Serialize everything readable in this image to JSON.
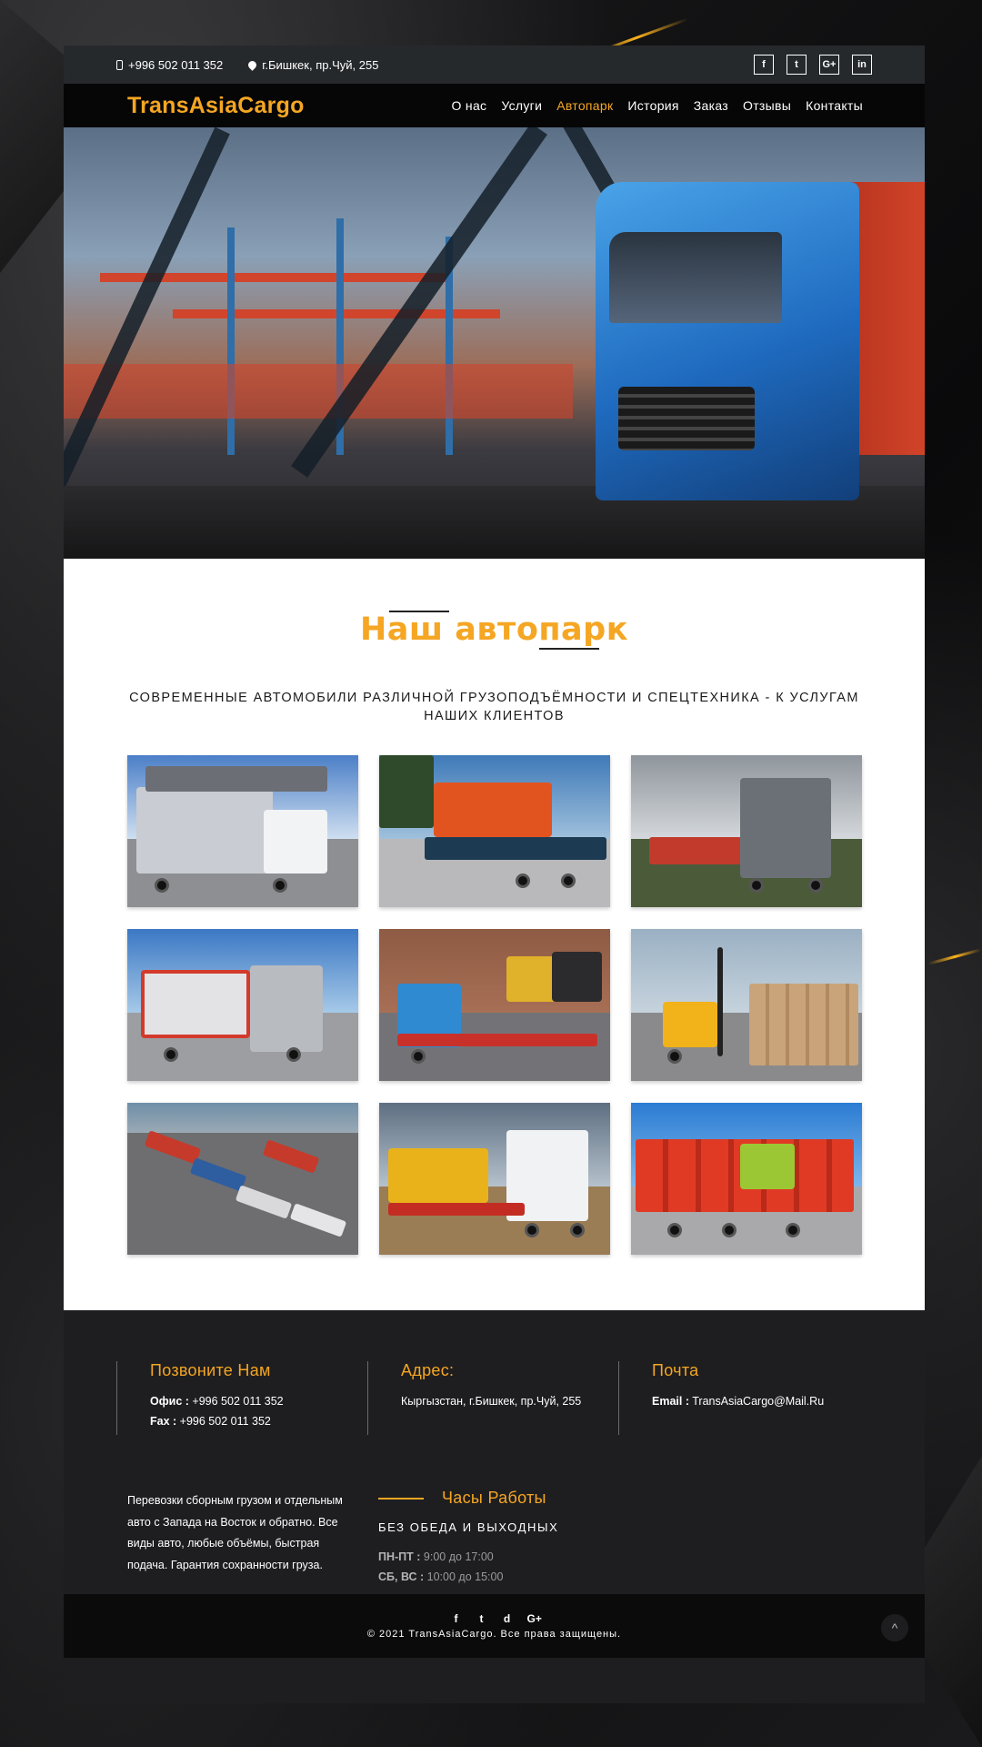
{
  "topbar": {
    "phone": "+996 502 011 352",
    "address": "г.Бишкек, пр.Чуй, 255",
    "socials": [
      "f",
      "t",
      "G+",
      "in"
    ]
  },
  "nav": {
    "logo": "TransAsiaCargo",
    "items": [
      "О нас",
      "Услуги",
      "Автопарк",
      "История",
      "Заказ",
      "Отзывы",
      "Контакты"
    ],
    "active": "Автопарк"
  },
  "fleet": {
    "title": "Наш автопарк",
    "subtitle": "СОВРЕМЕННЫЕ АВТОМОБИЛИ РАЗЛИЧНОЙ ГРУЗОПОДЪЁМНОСТИ И СПЕЦТЕХНИКА - К УСЛУГАМ НАШИХ КЛИЕНТОВ"
  },
  "contacts": {
    "call": {
      "title": "Позвоните Нам",
      "office_label": "Офис :",
      "office": "+996 502 011 352",
      "fax_label": "Fax :",
      "fax": "+996 502 011 352"
    },
    "address": {
      "title": "Адрес:",
      "text": "Кыргызстан, г.Бишкек, пр.Чуй, 255"
    },
    "mail": {
      "title": "Почта",
      "label": "Email :",
      "email": "TransAsiaCargo@Mail.Ru"
    }
  },
  "about": "Перевозки сборным грузом и отдельным авто с Запада на Восток и обратно. Все виды авто, любые объёмы, быстрая подача. Гарантия сохранности груза.",
  "hours": {
    "title": "Часы Работы",
    "subtitle": "БЕЗ ОБЕДА И ВЫХОДНЫХ",
    "weekdays_label": "ПН-ПТ :",
    "weekdays": "9:00 до 17:00",
    "weekend_label": "СБ, ВС :",
    "weekend": "10:00 до 15:00"
  },
  "bottom": {
    "icons": [
      "f",
      "t",
      "d",
      "G+"
    ],
    "copyright": "© 2021 TransAsiaCargo. Все права защищены.",
    "to_top": "^"
  },
  "colors": {
    "accent": "#f5a623",
    "dark": "#1e1e20",
    "black": "#060607"
  }
}
